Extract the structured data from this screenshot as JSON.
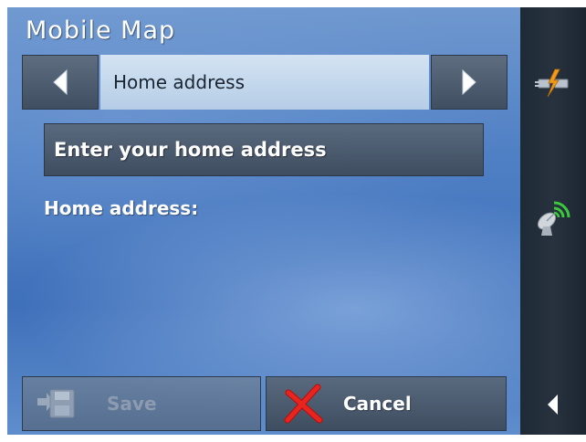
{
  "app": {
    "title": "Mobile Map"
  },
  "navigation": {
    "prev_icon": "left-arrow-icon",
    "next_icon": "right-arrow-icon",
    "current_label": "Home address"
  },
  "content": {
    "enter_button_label": "Enter your home address",
    "field_label": "Home address:"
  },
  "actions": {
    "save": {
      "label": "Save",
      "icon": "save-disk-icon",
      "enabled": false
    },
    "cancel": {
      "label": "Cancel",
      "icon": "red-x-icon",
      "enabled": true
    }
  },
  "sidebar": {
    "icons": [
      "power-plug-icon",
      "gps-satellite-icon",
      "collapse-arrow-icon"
    ]
  },
  "colors": {
    "accent_orange": "#f29a1c",
    "cancel_red": "#e0201c",
    "gps_green": "#3cc83c",
    "sidebar_bg": "#222d39"
  }
}
